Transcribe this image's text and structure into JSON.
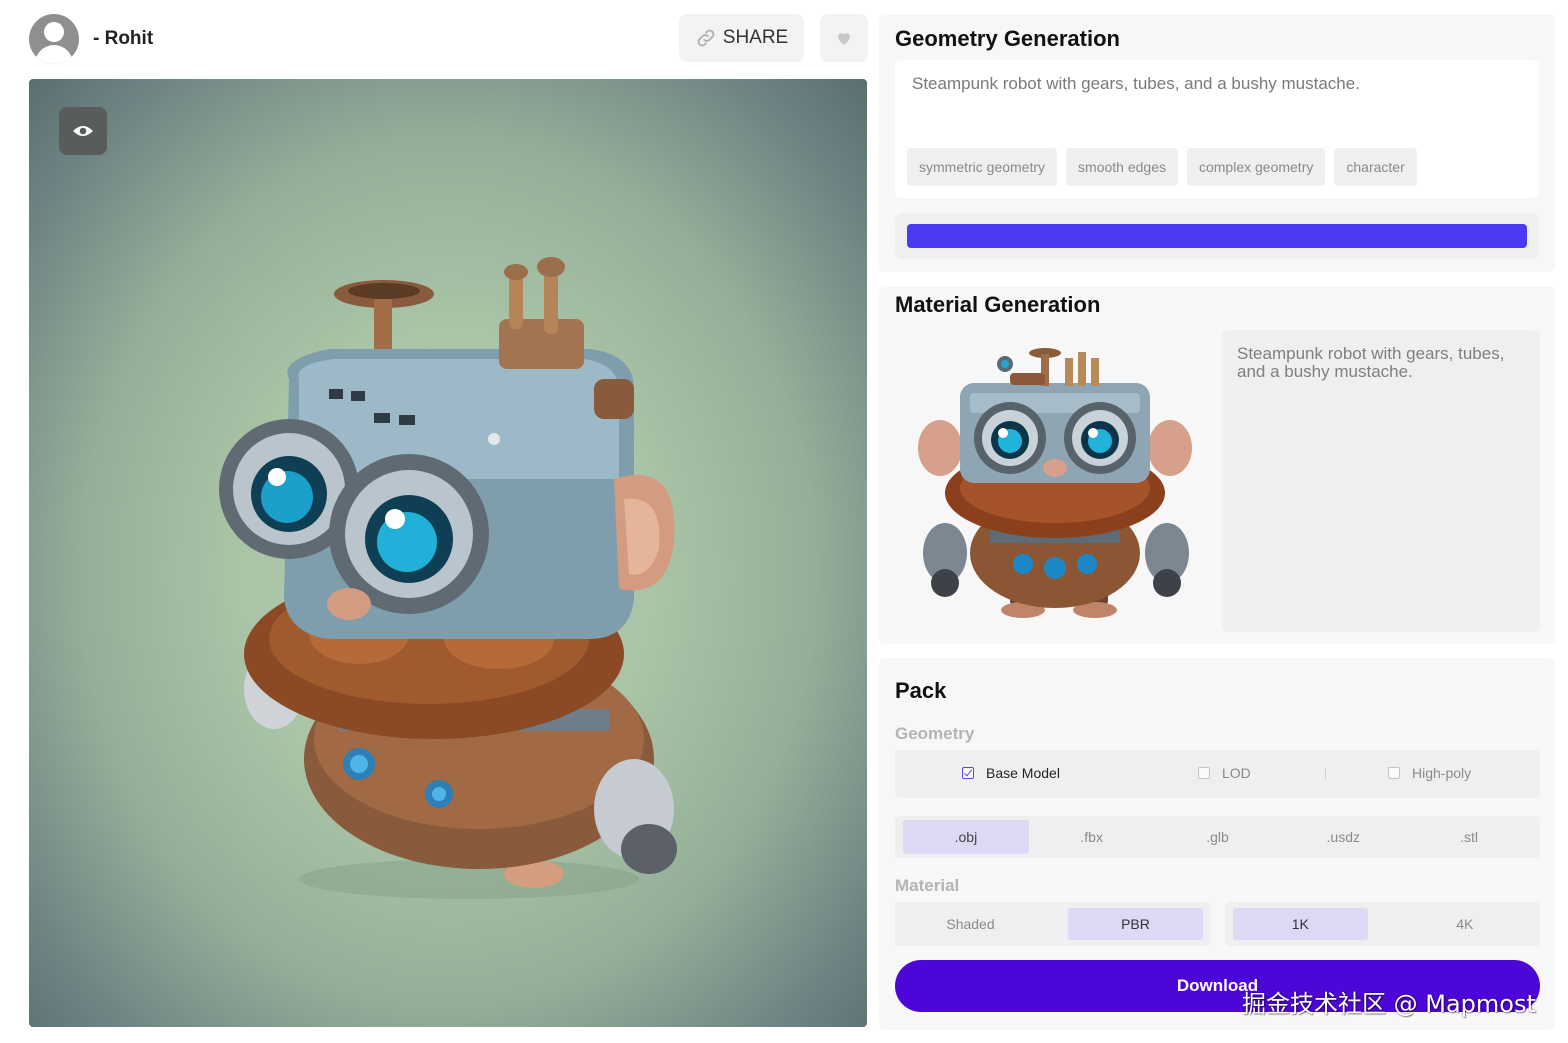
{
  "header": {
    "username": "- Rohit",
    "share_label": "SHARE",
    "icons": {
      "avatar": "user-avatar",
      "share": "link-icon",
      "like": "heart-icon",
      "eye": "eye-icon"
    }
  },
  "geometry": {
    "title": "Geometry Generation",
    "prompt": "Steampunk robot with gears, tubes, and a bushy mustache.",
    "tags": [
      "symmetric geometry",
      "smooth edges",
      "complex geometry",
      "character"
    ],
    "progress": 1.0
  },
  "material": {
    "title": "Material Generation",
    "prompt": "Steampunk robot with gears, tubes, and a bushy mustache."
  },
  "pack": {
    "title": "Pack",
    "geometry_label": "Geometry",
    "options": [
      {
        "label": "Base Model",
        "checked": true
      },
      {
        "label": "LOD",
        "checked": false
      },
      {
        "label": "High-poly",
        "checked": false
      }
    ],
    "formats": [
      ".obj",
      ".fbx",
      ".glb",
      ".usdz",
      ".stl"
    ],
    "selected_format": ".obj",
    "material_label": "Material",
    "shading": [
      "Shaded",
      "PBR"
    ],
    "selected_shading": "PBR",
    "resolution": [
      "1K",
      "4K"
    ],
    "selected_resolution": "1K",
    "download_label": "Download"
  },
  "watermark": "掘金技术社区 @ Mapmost",
  "colors": {
    "accent": "#4d06d8",
    "progress": "#4a3af3",
    "selected": "#ddd8f4"
  }
}
